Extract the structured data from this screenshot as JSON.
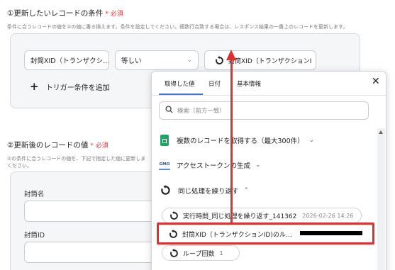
{
  "section1": {
    "title": "①更新したいレコードの条件",
    "required_star": "*",
    "required": "必須",
    "description": "条件に合うレコードの値を②の値に書き換えます。条件を設定してください。複数行合致する場合は、レスポンス結果の一番上のレコードを更新します。",
    "field_select": "封筒XID（トランザクシ…",
    "operator_select": "等しい",
    "value_chip": "封筒XID（トランザクションI",
    "add_trigger_plus": "+",
    "add_trigger_label": "トリガー条件を追加"
  },
  "section2": {
    "title": "②更新後のレコードの値",
    "required_star": "*",
    "required": "必須",
    "description_line1": "①の条件に合うレコードの値を、下記で指定した値に更新しま",
    "description_line2": "ください。",
    "fields": [
      {
        "label": "封筒名"
      },
      {
        "label": "封筒ID"
      }
    ]
  },
  "popup": {
    "tabs": [
      "取得した値",
      "日付",
      "基本情報"
    ],
    "active_tab": 0,
    "close_symbol": "✕",
    "search_placeholder": "検索（前方一致）",
    "groups": [
      {
        "label": "複数のレコードを取得する（最大300件）",
        "icon": "google-sheets-icon",
        "caret": "⌄"
      },
      {
        "label": "アクセストークンの生成",
        "icon": "gmo-sign-icon",
        "caret": "⌄"
      },
      {
        "label": "同じ処理を繰り返す",
        "icon": "loop-icon",
        "caret": "⌃"
      }
    ],
    "items": [
      {
        "label": "実行時間_同じ処理を繰り返す_141362",
        "date": "2026-02-26 14:26"
      },
      {
        "label": "封筒XID（トランザクションID)のル…"
      },
      {
        "label": "ループ回数",
        "count": "1"
      }
    ],
    "gmo_logo_text": "GMO"
  },
  "colors": {
    "accent": "#3d6fe0",
    "annotation_red": "#e0302b",
    "required_red": "#e5323a",
    "sheets_green": "#1fa463"
  }
}
